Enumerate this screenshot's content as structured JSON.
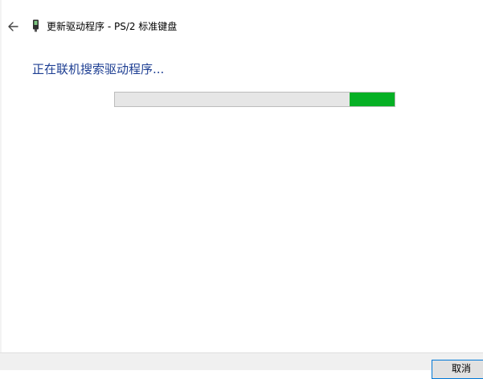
{
  "window": {
    "title": "更新驱动程序 - PS/2 标准键盘"
  },
  "status": {
    "heading": "正在联机搜索驱动程序..."
  },
  "progress": {
    "mode": "marquee",
    "chunk_start": 0.84,
    "chunk_end": 1.0
  },
  "footer": {
    "cancel_label": "取消"
  },
  "icons": {
    "back": "back-arrow-icon",
    "device": "keyboard-device-icon"
  },
  "colors": {
    "heading": "#1e3f93",
    "progress_fill": "#06b025",
    "progress_track": "#e6e6e6",
    "button_focus_border": "#0078d7"
  }
}
